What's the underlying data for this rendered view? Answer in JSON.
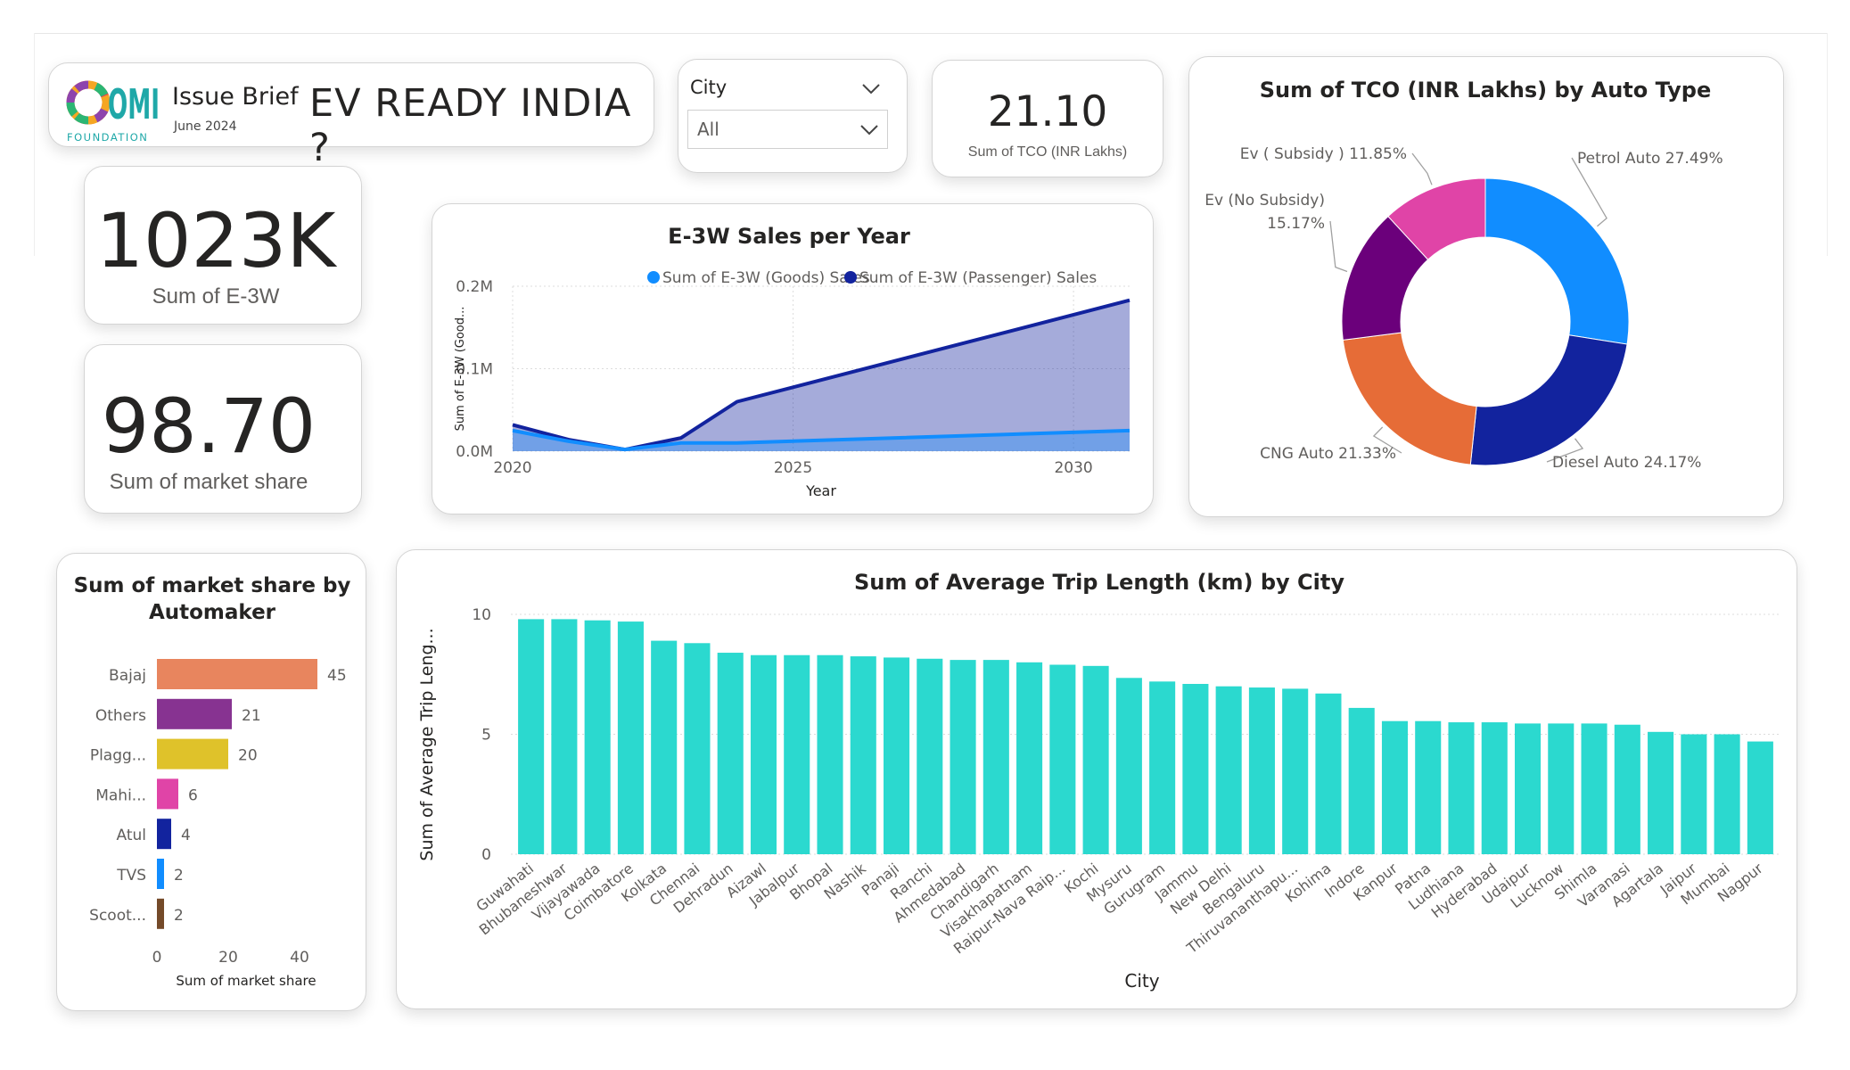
{
  "header": {
    "logo_text": "OMI",
    "logo_sub": "FOUNDATION",
    "brief_label": "Issue Brief",
    "brief_date": "June 2024",
    "title": "EV READY INDIA ?"
  },
  "slicer": {
    "label": "City",
    "value": "All"
  },
  "kpis": {
    "tco_value": "21.10",
    "tco_label": "Sum of TCO (INR Lakhs)",
    "e3w_value": "1023K",
    "e3w_label": "Sum of E-3W",
    "share_value": "98.70",
    "share_label": "Sum of market share"
  },
  "colors": {
    "goods": "#118DFF",
    "passenger": "#12239E",
    "trip_bar": "#2BD9CF"
  },
  "chart_data": [
    {
      "id": "sales",
      "type": "area",
      "title": "E-3W Sales per Year",
      "xlabel": "Year",
      "ylabel": "Sum of E-3W (Good...",
      "x": [
        2020,
        2021,
        2022,
        2023,
        2024,
        2031
      ],
      "series": [
        {
          "name": "Sum of E-3W (Goods) Sales",
          "color": "#118DFF",
          "values": [
            25000,
            12000,
            2000,
            10000,
            10000,
            25000
          ]
        },
        {
          "name": "Sum of E-3W (Passenger) Sales",
          "color": "#12239E",
          "values": [
            32000,
            14000,
            2000,
            16000,
            60000,
            183000
          ]
        }
      ],
      "xticks": [
        2020,
        2025,
        2030
      ],
      "xlim": [
        2020,
        2031
      ],
      "yticks": [
        0,
        100000,
        200000
      ],
      "ytick_labels": [
        "0.0M",
        "0.1M",
        "0.2M"
      ],
      "ylim": [
        0,
        200000
      ],
      "grid": true,
      "legend": "top-right"
    },
    {
      "id": "tco",
      "type": "pie",
      "title": "Sum of TCO (INR Lakhs) by Auto Type",
      "slices": [
        {
          "label": "Petrol Auto",
          "pct_label": "27.49%",
          "value": 27.49,
          "color": "#118DFF"
        },
        {
          "label": "Diesel Auto",
          "pct_label": "24.17%",
          "value": 24.17,
          "color": "#12239E"
        },
        {
          "label": "CNG Auto",
          "pct_label": "21.33%",
          "value": 21.33,
          "color": "#E66C37"
        },
        {
          "label": "Ev (No Subsidy)",
          "pct_label": "15.17%",
          "value": 15.17,
          "color": "#6B007B"
        },
        {
          "label": "Ev ( Subsidy )",
          "pct_label": "11.85%",
          "value": 11.85,
          "color": "#E044A7"
        }
      ]
    },
    {
      "id": "automaker",
      "type": "bar",
      "title": "Sum of market share by Automaker",
      "xlabel": "Sum of market share",
      "categories": [
        "Bajaj",
        "Others",
        "Plagg...",
        "Mahi...",
        "Atul",
        "TVS",
        "Scoot..."
      ],
      "values": [
        45,
        21,
        20,
        6,
        4,
        2,
        2
      ],
      "colors": [
        "#E8855E",
        "#873391",
        "#DFC22A",
        "#E044A7",
        "#12239E",
        "#118DFF",
        "#744A29"
      ],
      "xticks": [
        0,
        20,
        40
      ],
      "xlim": [
        0,
        50
      ]
    },
    {
      "id": "trip",
      "type": "bar",
      "title": "Sum of Average Trip Length (km) by City",
      "xlabel": "City",
      "ylabel": "Sum of Average Trip Leng...",
      "categories": [
        "Guwahati",
        "Bhubaneshwar",
        "Vijayawada",
        "Coimbatore",
        "Kolkata",
        "Chennai",
        "Dehradun",
        "Aizawl",
        "Jabalpur",
        "Bhopal",
        "Nashik",
        "Panaji",
        "Ranchi",
        "Ahmedabad",
        "Chandigarh",
        "Visakhapatnam",
        "Raipur-Nava Raip...",
        "Kochi",
        "Mysuru",
        "Gurugram",
        "Jammu",
        "New Delhi",
        "Bengaluru",
        "Thiruvananthapu...",
        "Kohima",
        "Indore",
        "Kanpur",
        "Patna",
        "Ludhiana",
        "Hyderabad",
        "Udaipur",
        "Lucknow",
        "Shimla",
        "Varanasi",
        "Agartala",
        "Jaipur",
        "Mumbai",
        "Nagpur"
      ],
      "values": [
        9.8,
        9.8,
        9.75,
        9.7,
        8.9,
        8.8,
        8.4,
        8.3,
        8.3,
        8.3,
        8.25,
        8.2,
        8.15,
        8.1,
        8.1,
        8.0,
        7.9,
        7.85,
        7.35,
        7.2,
        7.1,
        7.0,
        6.95,
        6.9,
        6.7,
        6.1,
        5.55,
        5.55,
        5.5,
        5.5,
        5.45,
        5.45,
        5.45,
        5.4,
        5.1,
        5.0,
        5.0,
        4.7
      ],
      "yticks": [
        0,
        5,
        10
      ],
      "ylim": [
        0,
        10.5
      ],
      "grid": true
    }
  ]
}
